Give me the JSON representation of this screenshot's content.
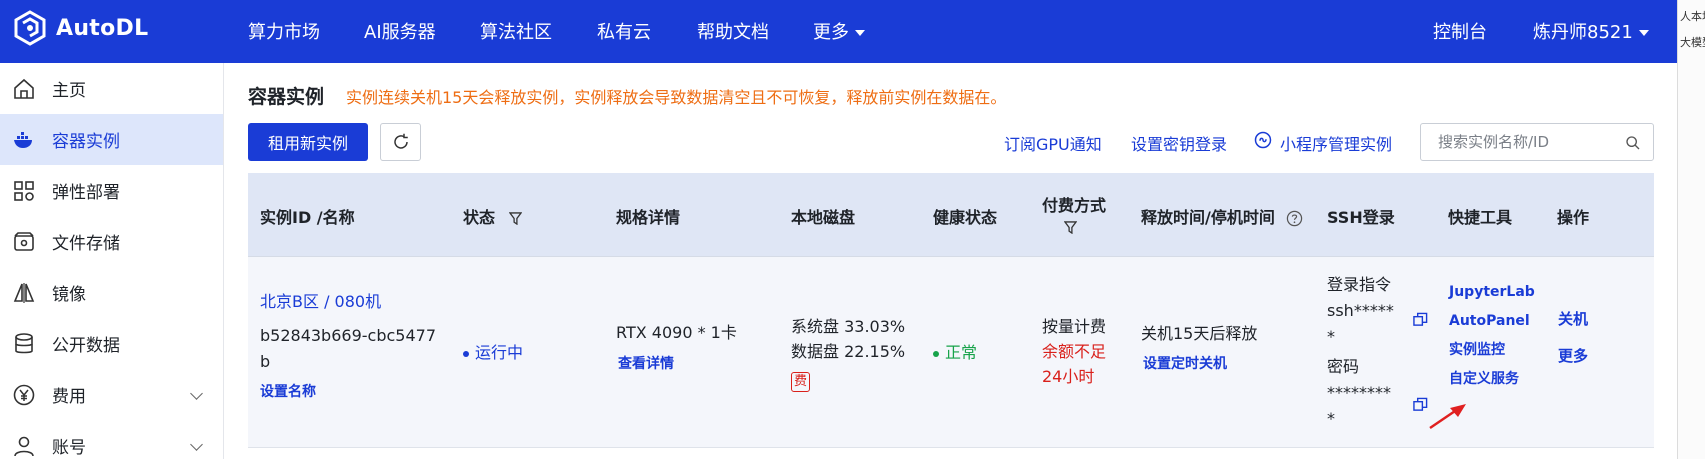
{
  "app": {
    "logo_text": "AutoDL"
  },
  "nav": {
    "items": [
      "算力市场",
      "AI服务器",
      "算法社区",
      "私有云",
      "帮助文档",
      "更多"
    ],
    "console": "控制台",
    "user": "炼丹师8521"
  },
  "edge_text": [
    "人本地",
    "大模型"
  ],
  "sidebar": {
    "items": [
      {
        "label": "主页",
        "icon": "home-icon"
      },
      {
        "label": "容器实例",
        "icon": "docker-icon"
      },
      {
        "label": "弹性部署",
        "icon": "grid-icon"
      },
      {
        "label": "文件存储",
        "icon": "storage-icon"
      },
      {
        "label": "镜像",
        "icon": "mirror-icon"
      },
      {
        "label": "公开数据",
        "icon": "database-icon"
      },
      {
        "label": "费用",
        "icon": "yen-icon"
      },
      {
        "label": "账号",
        "icon": "user-icon"
      }
    ]
  },
  "main": {
    "title": "容器实例",
    "warning": "实例连续关机15天会释放实例，实例释放会导致数据清空且不可恢复，释放前实例在数据在。",
    "rent_button": "租用新实例",
    "links": {
      "gpu_notify": "订阅GPU通知",
      "ssh_key": "设置密钥登录",
      "mini_program": "小程序管理实例"
    },
    "search_placeholder": "搜索实例名称/ID"
  },
  "table": {
    "headers": {
      "id": "实例ID /名称",
      "status": "状态",
      "spec": "规格详情",
      "disk": "本地磁盘",
      "health": "健康状态",
      "pay_line1": "付费方式",
      "release": "释放时间/停机时间",
      "ssh": "SSH登录",
      "tools": "快捷工具",
      "ops": "操作"
    },
    "row": {
      "region": "北京B区 / 080机",
      "id_line1": "b52843b669-cbc5477",
      "id_line2": "b",
      "set_name": "设置名称",
      "status": "运行中",
      "spec": "RTX 4090 * 1卡",
      "spec_detail": "查看详情",
      "sys_disk": "系统盘 33.03%",
      "data_disk": "数据盘 22.15%",
      "fee_badge": "费",
      "health": "正常",
      "pay_type": "按量计费",
      "balance_line1": "余额不足",
      "balance_line2": "24小时",
      "release": "关机15天后释放",
      "timed_shutdown": "设置定时关机",
      "ssh_cmd_label": "登录指令",
      "ssh_cmd": "ssh*****",
      "ssh_cmd_tail": "*",
      "pwd_label": "密码",
      "pwd": "********",
      "pwd_tail": "*",
      "tools": [
        "JupyterLab",
        "AutoPanel",
        "实例监控",
        "自定义服务"
      ],
      "ops": [
        "关机",
        "更多"
      ]
    }
  },
  "colors": {
    "brand": "#1a3cd6",
    "warning": "#ee6d13",
    "danger": "#d9201b",
    "ok": "#17a34a"
  }
}
